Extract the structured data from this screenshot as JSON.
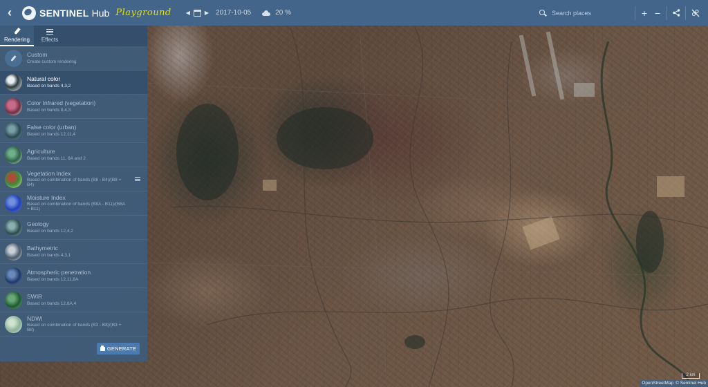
{
  "header": {
    "brand_name": "SENTINEL",
    "brand_hub": "Hub",
    "brand_tag": "Playground",
    "date": "2017-10-05",
    "cloud_coverage": "20 %",
    "search_placeholder": "Search places",
    "zoom_in_label": "+",
    "zoom_out_label": "−"
  },
  "sidebar": {
    "tabs": [
      {
        "label": "Rendering",
        "active": true
      },
      {
        "label": "Effects",
        "active": false
      }
    ],
    "items": [
      {
        "title": "Custom",
        "subtitle": "Create custom rendering"
      },
      {
        "title": "Natural color",
        "subtitle": "Based on bands 4,3,2"
      },
      {
        "title": "Color Infrared (vegetation)",
        "subtitle": "Based on bands 8,4,3"
      },
      {
        "title": "False color (urban)",
        "subtitle": "Based on bands 12,11,4"
      },
      {
        "title": "Agriculture",
        "subtitle": "Based on bands 11, 8A and 2"
      },
      {
        "title": "Vegetation Index",
        "subtitle": "Based on combination of bands (B8 - B4)/(B8 + B4)"
      },
      {
        "title": "Moisture Index",
        "subtitle": "Based on combination of bands (B8A - B11)/(B8A + B11)"
      },
      {
        "title": "Geology",
        "subtitle": "Based on bands 12,4,2"
      },
      {
        "title": "Bathymetric",
        "subtitle": "Based on bands 4,3,1"
      },
      {
        "title": "Atmospheric penetration",
        "subtitle": "Based on bands 12,11,8A"
      },
      {
        "title": "SWIR",
        "subtitle": "Based on bands 12,8A,4"
      },
      {
        "title": "NDWI",
        "subtitle": "Based on combination of bands (B3 - B8)/(B3 + B8)"
      }
    ],
    "selected_index": 1,
    "generate_label": "GENERATE"
  },
  "map": {
    "scale_label": "2 km",
    "attribution": [
      "OpenStreetMap",
      "© Sentinel Hub"
    ]
  },
  "colors": {
    "topbar": "#43658a",
    "sidebar": "#3e5c7c",
    "brand_tag": "#e6e100",
    "generate_button": "#4a7ab0"
  }
}
